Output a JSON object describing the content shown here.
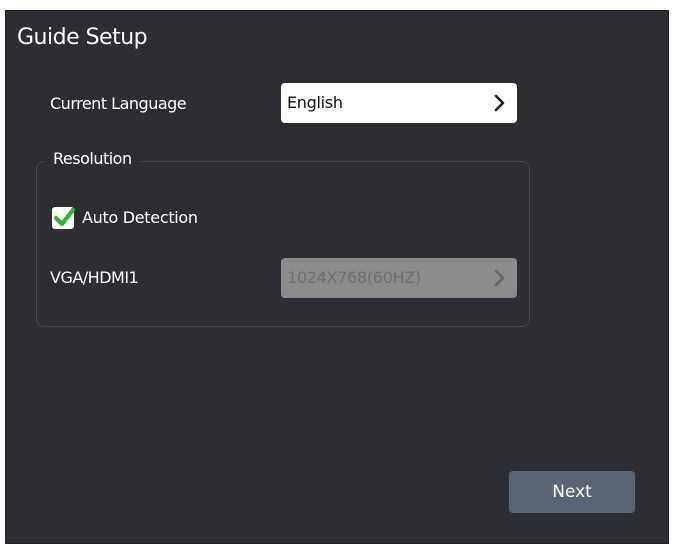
{
  "dialog": {
    "title": "Guide Setup"
  },
  "language": {
    "label": "Current Language",
    "value": "English"
  },
  "resolution": {
    "group_label": "Resolution",
    "auto_detection": {
      "label": "Auto Detection",
      "checked": true
    },
    "output": {
      "label": "VGA/HDMI1",
      "value": "1024X768(60HZ)",
      "enabled": false
    }
  },
  "footer": {
    "next_label": "Next"
  },
  "colors": {
    "background": "#2d2e33",
    "check": "#2db52d",
    "button": "#5a6574"
  }
}
